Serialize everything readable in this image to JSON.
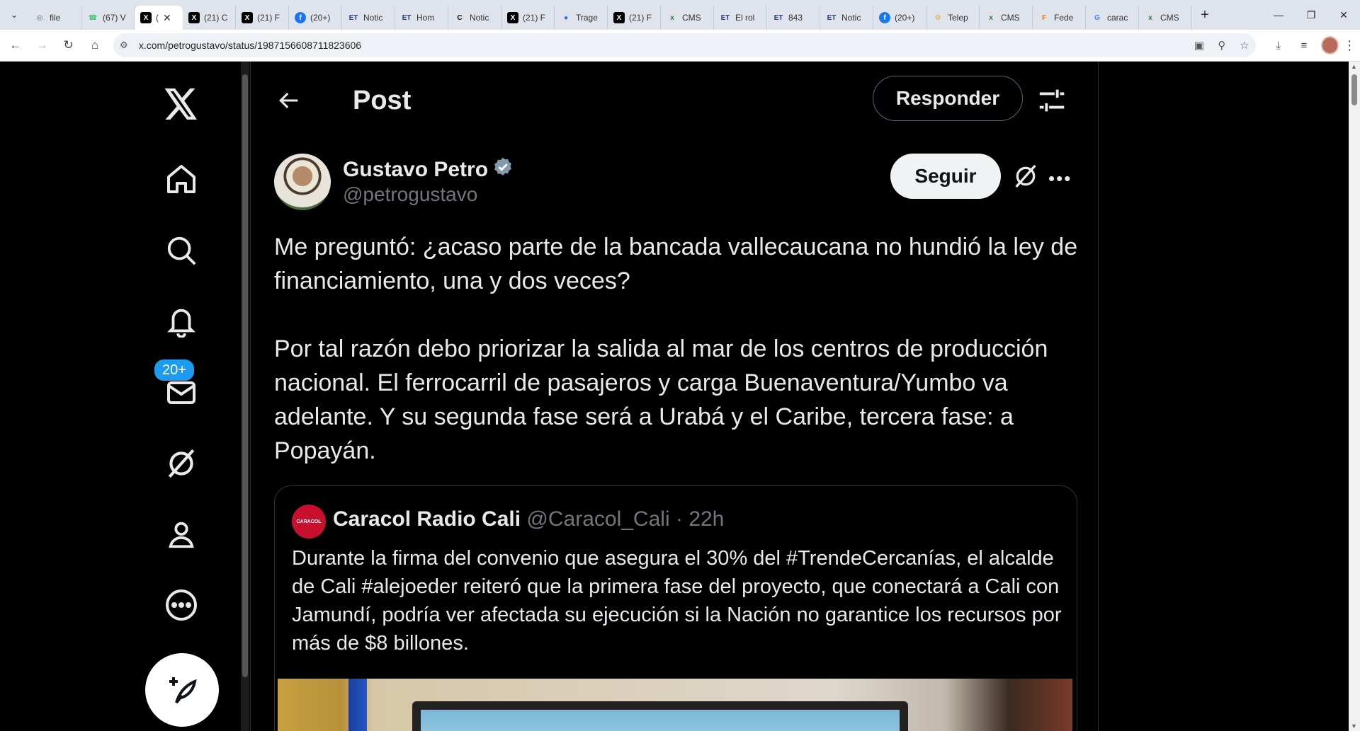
{
  "browser": {
    "tabs": [
      {
        "title": "file",
        "icon": "globe-icon",
        "color": "#5f6368"
      },
      {
        "title": "(67) V",
        "icon": "whatsapp-icon",
        "color": "#25d366"
      },
      {
        "title": "(",
        "icon": "x-logo-icon",
        "color": "#000000",
        "active": true
      },
      {
        "title": "(21) C",
        "icon": "x-logo-icon",
        "color": "#000000"
      },
      {
        "title": "(21) F",
        "icon": "x-logo-icon",
        "color": "#000000"
      },
      {
        "title": "(20+)",
        "icon": "facebook-icon",
        "color": "#1877f2"
      },
      {
        "title": "Notic",
        "icon": "et-icon",
        "color": "#1d3f8a"
      },
      {
        "title": "Hom",
        "icon": "et-icon",
        "color": "#1d3f8a"
      },
      {
        "title": "Notic",
        "icon": "c-icon",
        "color": "#111111"
      },
      {
        "title": "(21) F",
        "icon": "x-logo-icon",
        "color": "#000000"
      },
      {
        "title": "Trage",
        "icon": "circle-icon",
        "color": "#1a73e8"
      },
      {
        "title": "(21) F",
        "icon": "x-logo-icon",
        "color": "#000000"
      },
      {
        "title": "CMS",
        "icon": "cms-icon",
        "color": "#2e7d32"
      },
      {
        "title": "El rol",
        "icon": "et-icon",
        "color": "#1d3f8a"
      },
      {
        "title": "843",
        "icon": "et-icon",
        "color": "#1d3f8a"
      },
      {
        "title": "Notic",
        "icon": "et-icon",
        "color": "#1d3f8a"
      },
      {
        "title": "(20+)",
        "icon": "facebook-icon",
        "color": "#1877f2"
      },
      {
        "title": "Telep",
        "icon": "gear-icon",
        "color": "#f5a623"
      },
      {
        "title": "CMS",
        "icon": "cms-icon",
        "color": "#2e7d32"
      },
      {
        "title": "Fede",
        "icon": "f-icon",
        "color": "#f57c00"
      },
      {
        "title": "carac",
        "icon": "google-icon",
        "color": "#4285f4"
      },
      {
        "title": "CMS",
        "icon": "cms-icon",
        "color": "#2e7d32"
      }
    ],
    "url": "x.com/petrogustavo/status/1987156608711823606"
  },
  "sidebar": {
    "notifications_badge": "20+"
  },
  "header": {
    "title": "Post",
    "reply_label": "Responder"
  },
  "post": {
    "author_name": "Gustavo Petro",
    "author_handle": "@petrogustavo",
    "follow_label": "Seguir",
    "text": "Me preguntó: ¿acaso parte de la bancada vallecaucana no hundió la ley de financiamiento, una y dos veces?\n\nPor tal razón debo priorizar la salida al mar de los centros de producción nacional. El ferrocarril de pasajeros y carga Buenaventura/Yumbo va adelante. Y su segunda fase será a Urabá y el Caribe, tercera fase: a Popayán."
  },
  "quote": {
    "avatar_text": "CARACOL",
    "name": "Caracol Radio Cali",
    "handle": "@Caracol_Cali",
    "separator": "·",
    "time": "22h",
    "text": "Durante la firma del convenio que asegura el 30% del #TrendeCercanías, el alcalde de Cali #alejoeder reiteró que la primera fase del proyecto, que conectará a Cali con Jamundí, podría ver afectada su ejecución si la Nación no garantice los recursos por más de $8 billones."
  },
  "colors": {
    "background": "#000000",
    "text": "#e7e9ea",
    "muted": "#71767b",
    "border": "#2f3336",
    "accent": "#1d9bf0"
  }
}
